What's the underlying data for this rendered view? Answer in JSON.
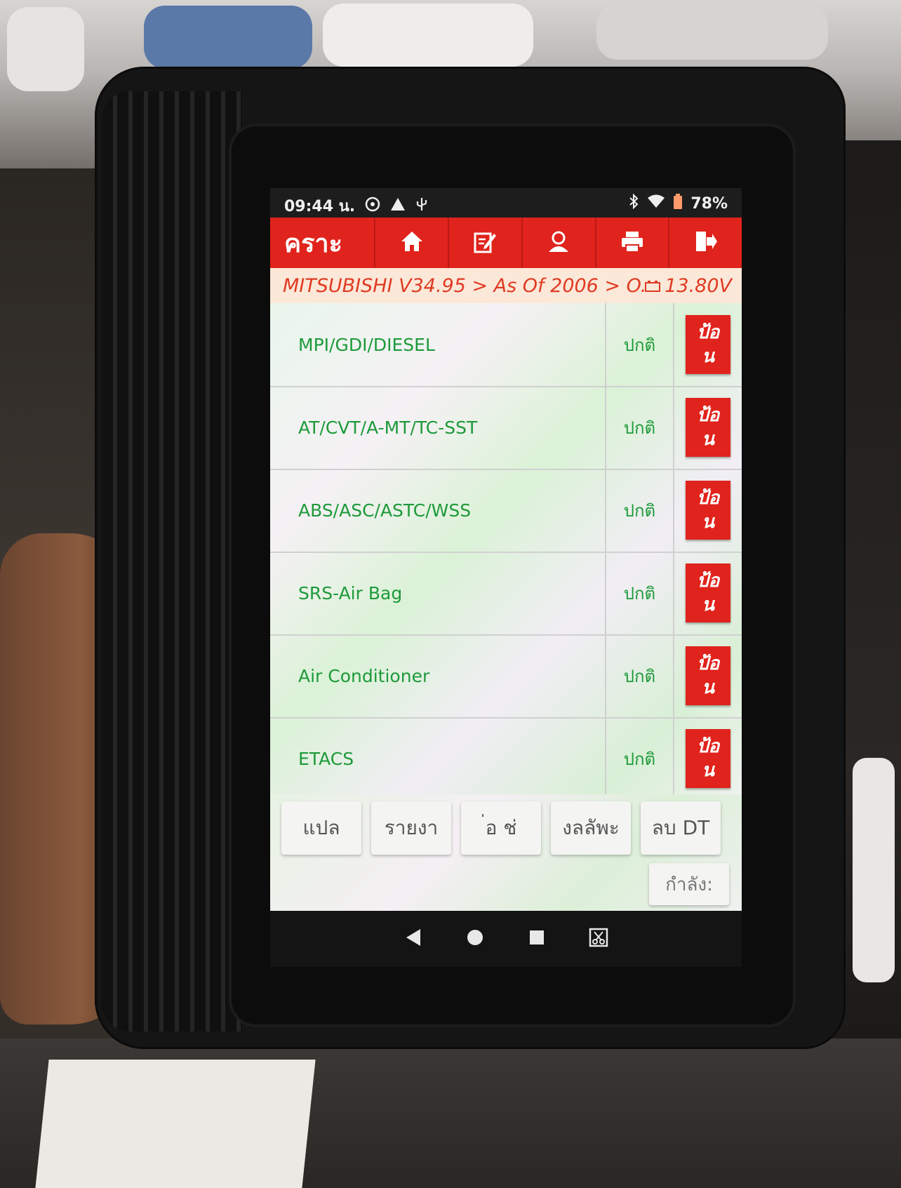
{
  "statusbar": {
    "time": "09:44 น.",
    "battery": "78%"
  },
  "toolbar": {
    "title": "คราะ",
    "buttons": [
      {
        "icon": "home-icon"
      },
      {
        "icon": "edit-report-icon"
      },
      {
        "icon": "support-person-icon"
      },
      {
        "icon": "print-icon"
      },
      {
        "icon": "exit-icon"
      }
    ]
  },
  "breadcrumb": {
    "path": "MITSUBISHI V34.95 > As Of 2006 > O...",
    "voltage": "13.80V"
  },
  "systems": [
    {
      "name": "MPI/GDI/DIESEL",
      "status": "ปกติ",
      "action": "ป้อ\nน"
    },
    {
      "name": "AT/CVT/A-MT/TC-SST",
      "status": "ปกติ",
      "action": "ป้อ\nน"
    },
    {
      "name": "ABS/ASC/ASTC/WSS",
      "status": "ปกติ",
      "action": "ป้อ\nน"
    },
    {
      "name": "SRS-Air Bag",
      "status": "ปกติ",
      "action": "ป้อ\nน"
    },
    {
      "name": "Air Conditioner",
      "status": "ปกติ",
      "action": "ป้อ\nน"
    },
    {
      "name": "ETACS",
      "status": "ปกติ",
      "action": "ป้อ\nน"
    }
  ],
  "functions": {
    "btn1": "แปล",
    "btn2": "รายงา",
    "btn3": "่อ ช่",
    "btn4": "งลลัพะ",
    "btn5": "ลบ DT",
    "btn6": "กำลัง:"
  },
  "colors": {
    "accent": "#e0231c",
    "ok_text": "#1d9a3a"
  }
}
